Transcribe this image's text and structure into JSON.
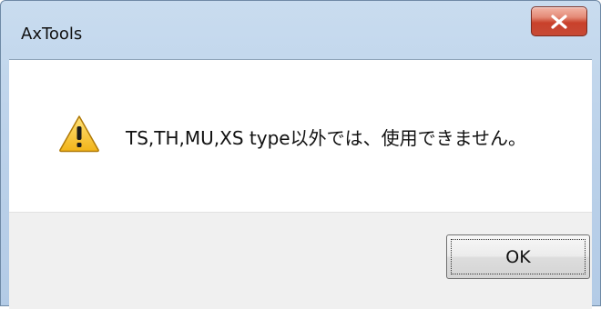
{
  "window": {
    "title": "AxTools"
  },
  "titlebar": {
    "close_icon": "close-x-icon"
  },
  "dialog": {
    "icon": "warning-triangle-icon",
    "message": "TS,TH,MU,XS type以外では、使用できません。"
  },
  "buttons": {
    "ok_label": "OK"
  },
  "colors": {
    "close_button": "#c9412b",
    "warning_yellow": "#f6c63a",
    "button_bar": "#f0f0f0"
  }
}
